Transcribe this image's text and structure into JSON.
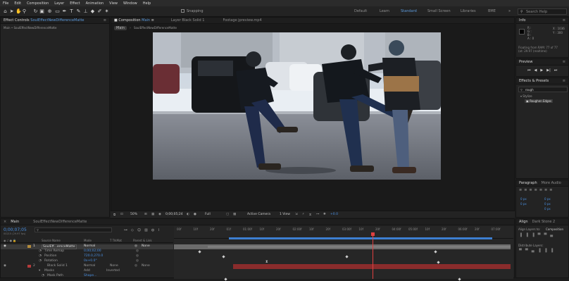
{
  "menu": [
    "File",
    "Edit",
    "Composition",
    "Layer",
    "Effect",
    "Animation",
    "View",
    "Window",
    "Help"
  ],
  "toolbar": {
    "snapping": "Snapping",
    "workspaces": [
      "Default",
      "Learn",
      "Standard",
      "Small Screen",
      "Libraries",
      "ВМЕ"
    ],
    "active_workspace": "Standard",
    "search_placeholder": "Search Help"
  },
  "left_panel": {
    "tab": "Effect Controls",
    "tab_target": "SoulEffectNewDifferenceMatte",
    "crumb": "Main • SoulEffectNewDifferenceMatte"
  },
  "viewer": {
    "tab_composition": "Composition",
    "tab_composition_name": "Main",
    "tab_layer": "Layer Black Solid 1",
    "tab_footage": "Footage jpreview.mp4",
    "comp_chip": "Main",
    "comp_path": "SoulEffectNewDifferenceMatte",
    "footer": {
      "zoom": "50%",
      "timecode": "0;00;05;24",
      "resolution": "Full",
      "camera": "Active Camera",
      "views": "1 View",
      "exposure": "+0.0"
    }
  },
  "info_panel": {
    "title": "Info",
    "channels": [
      "R :",
      "G :",
      "B :",
      "A : 0"
    ],
    "coords": [
      "X : 1036",
      "Y : 300"
    ],
    "caching": [
      "Floating from RAM: 77 of 77",
      "(at: 29.97 (realtime)"
    ]
  },
  "preview_panel": {
    "title": "Preview"
  },
  "effects_panel": {
    "title": "Effects & Presets",
    "search_value": "rough",
    "category": "Stylize",
    "item": "Roughen Edges"
  },
  "paragraph_panel": {
    "tab1": "Paragraph",
    "tab2": "More Audio",
    "fields": [
      "0 px",
      "0 px",
      "0 px",
      "0 px",
      "0 px"
    ]
  },
  "align_panel": {
    "tab1": "Align",
    "tab2": "Dark Stone 2",
    "align_to_label": "Align Layers to:",
    "align_to_value": "Composition",
    "distribute": "Distribute Layers:"
  },
  "timeline": {
    "tab": "Main",
    "tab2": "SoulEffectNewDifferenceMatte",
    "timecode": "0;00;07;05",
    "frame_info": "00215 (29.97 fps)",
    "search_placeholder": "",
    "columns": [
      "Source Name",
      "Mode",
      "T TrkMat",
      "Parent & Link"
    ],
    "ruler": [
      "00f",
      "10f",
      "20f",
      "01f",
      "01:00f",
      "10f",
      "20f",
      "02:00f",
      "10f",
      "20f",
      "03:00f",
      "10f",
      "20f",
      "04:00f",
      "05:00f",
      "10f",
      "20f",
      "06:00f",
      "20f",
      "07:00f"
    ],
    "layers": [
      {
        "num": "1",
        "name": "SoulEff...ernceMatte",
        "mode": "Normal",
        "trkmat": "",
        "parent": "None",
        "selected": true
      },
      {
        "num": "",
        "name": "Time Remap",
        "mode": "0;00;02;00",
        "trkmat": "",
        "parent": "",
        "selected": false
      },
      {
        "num": "",
        "name": "Position",
        "mode": "720.0,270.0",
        "trkmat": "",
        "parent": "",
        "selected": false
      },
      {
        "num": "",
        "name": "Rotation",
        "mode": "0x+0.0°",
        "trkmat": "",
        "parent": "",
        "selected": false
      },
      {
        "num": "2",
        "name": "Black Solid 1",
        "mode": "Normal",
        "trkmat": "None",
        "parent": "None",
        "selected": false
      },
      {
        "num": "",
        "name": "Masks",
        "mode": "Add",
        "trkmat": "Inverted",
        "parent": "",
        "selected": false
      },
      {
        "num": "",
        "name": "Mask Path",
        "mode": "Shape...",
        "trkmat": "",
        "parent": "",
        "selected": false
      }
    ]
  },
  "colors": {
    "accent": "#2d8ceb",
    "timecode": "#4a90e2",
    "bg": "#1d1d1d",
    "panel": "#232323",
    "track_gray": "#6b6b6b",
    "track_red": "#8a2c2c"
  }
}
